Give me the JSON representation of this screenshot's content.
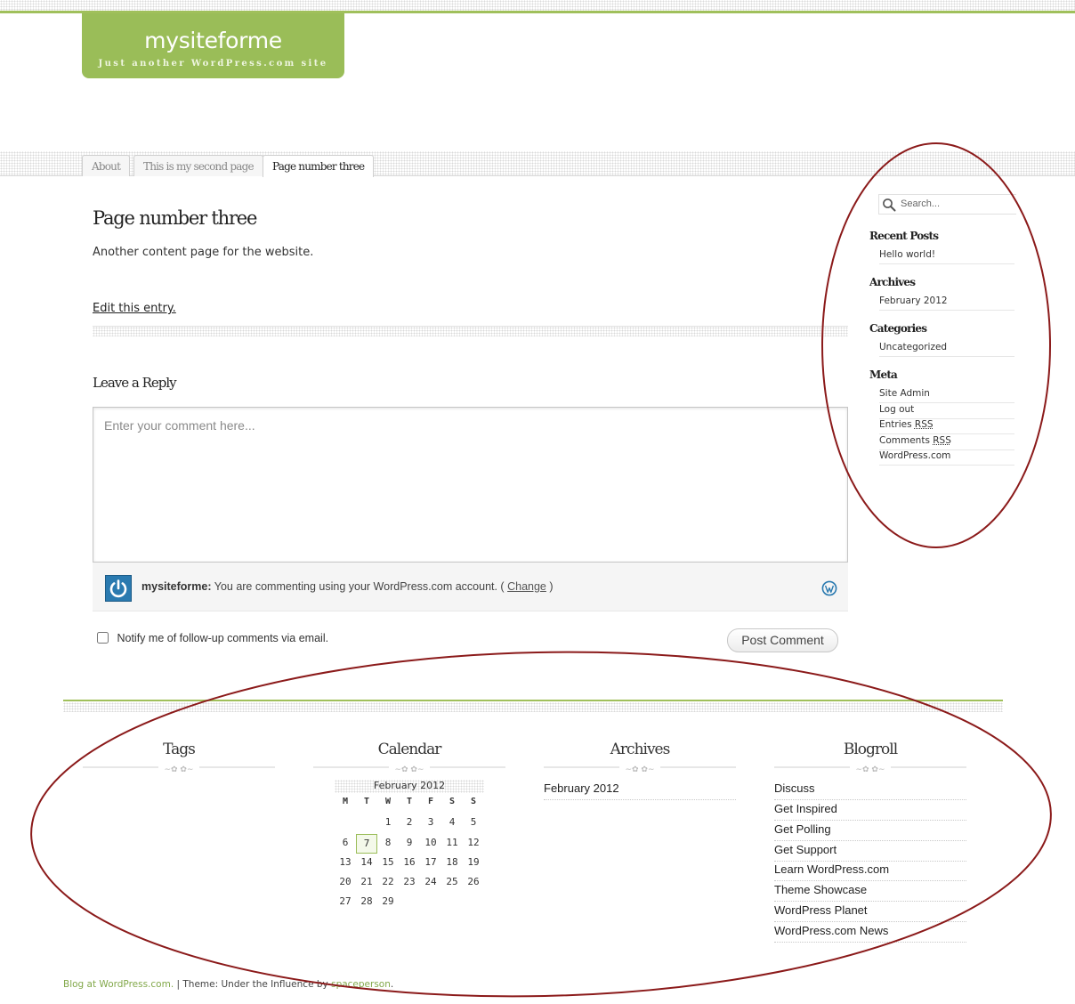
{
  "header": {
    "site_title": "mysiteforme",
    "site_description": "Just another WordPress.com site"
  },
  "nav": {
    "tabs": [
      {
        "label": "About",
        "active": false
      },
      {
        "label": "This is my second page",
        "active": false
      },
      {
        "label": "Page number three",
        "active": true
      }
    ]
  },
  "page": {
    "title": "Page number three",
    "body": "Another content page for the website.",
    "edit_link": "Edit this entry."
  },
  "reply": {
    "title": "Leave a Reply",
    "comment_placeholder": "Enter your comment here...",
    "user": "mysiteforme:",
    "identity_text": "You are commenting using your WordPress.com account. (",
    "change_link": "Change",
    "identity_close": ")",
    "notify_label": "Notify me of follow-up comments via email.",
    "post_button": "Post Comment"
  },
  "sidebar": {
    "search_placeholder": "Search...",
    "recent_posts": {
      "title": "Recent Posts",
      "items": [
        "Hello world!"
      ]
    },
    "archives": {
      "title": "Archives",
      "items": [
        "February 2012"
      ]
    },
    "categories": {
      "title": "Categories",
      "items": [
        "Uncategorized"
      ]
    },
    "meta": {
      "title": "Meta",
      "site_admin": "Site Admin",
      "log_out": "Log out",
      "entries": "Entries",
      "comments": "Comments",
      "rss": "RSS",
      "wordpress": "WordPress.com"
    }
  },
  "footer": {
    "tags_title": "Tags",
    "calendar_title": "Calendar",
    "archives_title": "Archives",
    "blogroll_title": "Blogroll",
    "archives_items": [
      "February 2012"
    ],
    "blogroll_items": [
      "Discuss",
      "Get Inspired",
      "Get Polling",
      "Get Support",
      "Learn WordPress.com",
      "Theme Showcase",
      "WordPress Planet",
      "WordPress.com News"
    ],
    "credits": {
      "blog_at": "Blog at WordPress.com.",
      "sep": " | Theme: Under the Influence by ",
      "author": "spaceperson",
      "end": "."
    }
  },
  "calendar": {
    "caption": "February 2012",
    "weekdays": [
      "M",
      "T",
      "W",
      "T",
      "F",
      "S",
      "S"
    ],
    "weeks": [
      [
        "",
        "",
        "1",
        "2",
        "3",
        "4",
        "5"
      ],
      [
        "6",
        "7",
        "8",
        "9",
        "10",
        "11",
        "12"
      ],
      [
        "13",
        "14",
        "15",
        "16",
        "17",
        "18",
        "19"
      ],
      [
        "20",
        "21",
        "22",
        "23",
        "24",
        "25",
        "26"
      ],
      [
        "27",
        "28",
        "29",
        "",
        "",
        "",
        ""
      ]
    ],
    "today": "7"
  },
  "colors": {
    "accent_green": "#9abd58",
    "annotation_red": "#8b1a1a",
    "wp_blue": "#2a7ab0"
  }
}
